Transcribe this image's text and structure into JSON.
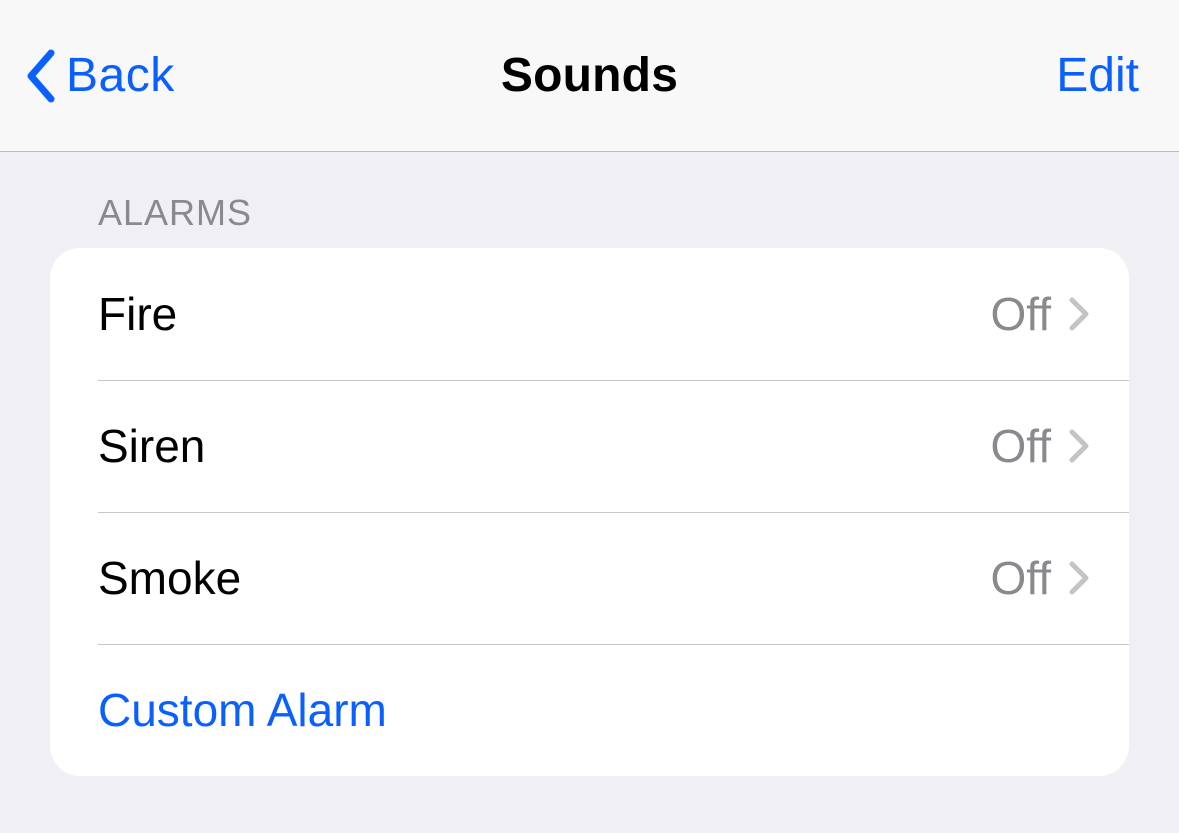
{
  "navbar": {
    "back_label": "Back",
    "title": "Sounds",
    "edit_label": "Edit"
  },
  "section": {
    "header": "ALARMS",
    "rows": [
      {
        "label": "Fire",
        "value": "Off"
      },
      {
        "label": "Siren",
        "value": "Off"
      },
      {
        "label": "Smoke",
        "value": "Off"
      }
    ],
    "action_label": "Custom Alarm"
  }
}
